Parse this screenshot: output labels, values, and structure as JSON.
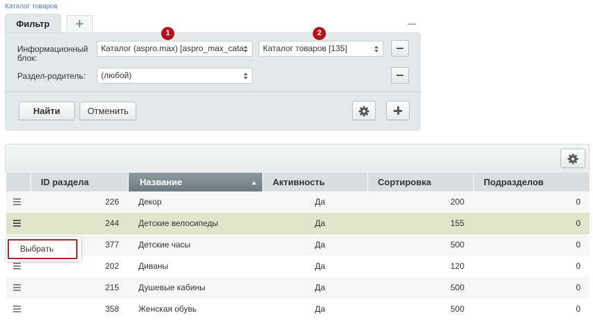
{
  "breadcrumb": "Каталог товаров",
  "filter": {
    "tab_label": "Фильтр",
    "add_tab_symbol": "+",
    "rows": [
      {
        "label": "Информационный блок:",
        "select1": "Каталог (aspro.max) [aspro_max_cata",
        "select2": "Каталог товаров [135]"
      },
      {
        "label": "Раздел-родитель:",
        "select1": "(любой)"
      }
    ],
    "badges": [
      "1",
      "2"
    ],
    "find_label": "Найти",
    "cancel_label": "Отменить"
  },
  "grid": {
    "columns": [
      "ID раздела",
      "Название",
      "Активность",
      "Сортировка",
      "Подразделов"
    ],
    "sorted_column": "Название",
    "rows": [
      {
        "id": "226",
        "name": "Декор",
        "active": "Да",
        "sort": "200",
        "sub": "0"
      },
      {
        "id": "244",
        "name": "Детские велосипеды",
        "active": "Да",
        "sort": "155",
        "sub": "0"
      },
      {
        "id": "377",
        "name": "Детские часы",
        "active": "Да",
        "sort": "500",
        "sub": "0"
      },
      {
        "id": "202",
        "name": "Диваны",
        "active": "Да",
        "sort": "120",
        "sub": "0"
      },
      {
        "id": "215",
        "name": "Душевые кабины",
        "active": "Да",
        "sort": "500",
        "sub": "0"
      },
      {
        "id": "358",
        "name": "Женская обувь",
        "active": "Да",
        "sort": "500",
        "sub": "0"
      }
    ]
  },
  "context_menu": {
    "item": "Выбрать"
  },
  "colors": {
    "accent_badge": "#b3121b",
    "link": "#2c5da6",
    "highlight_row": "#dfe4cb"
  },
  "icons": [
    "plus-icon",
    "minus-icon",
    "gear-icon",
    "menu-icon",
    "sort-asc-icon",
    "select-arrows-icon"
  ]
}
